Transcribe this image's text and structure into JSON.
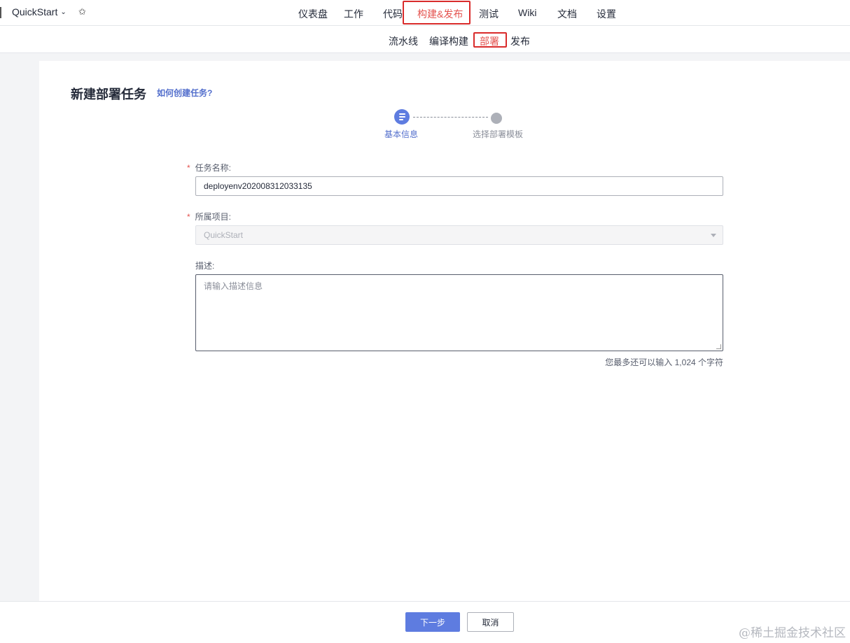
{
  "topbar": {
    "project": "QuickStart",
    "nav": [
      "仪表盘",
      "工作",
      "代码",
      "构建&发布",
      "测试",
      "Wiki",
      "文档",
      "设置"
    ],
    "active_nav": "构建&发布"
  },
  "subnav": {
    "items": [
      "流水线",
      "编译构建",
      "部署",
      "发布"
    ],
    "active": "部署"
  },
  "page": {
    "title": "新建部署任务",
    "help_link": "如何创建任务?"
  },
  "steps": {
    "step1": "基本信息",
    "step2": "选择部署模板",
    "current": 1
  },
  "form": {
    "task_name_label": "任务名称:",
    "task_name_value": "deployenv202008312033135",
    "project_label": "所属项目:",
    "project_value": "QuickStart",
    "desc_label": "描述:",
    "desc_placeholder": "请输入描述信息",
    "counter_text": "您最多还可以输入 1,024 个字符"
  },
  "footer": {
    "next": "下一步",
    "cancel": "取消",
    "watermark": "@稀土掘金技术社区"
  },
  "colors": {
    "accent": "#5e7ce0",
    "active_nav": "#e4534f",
    "highlight_box": "#d92b2b"
  }
}
